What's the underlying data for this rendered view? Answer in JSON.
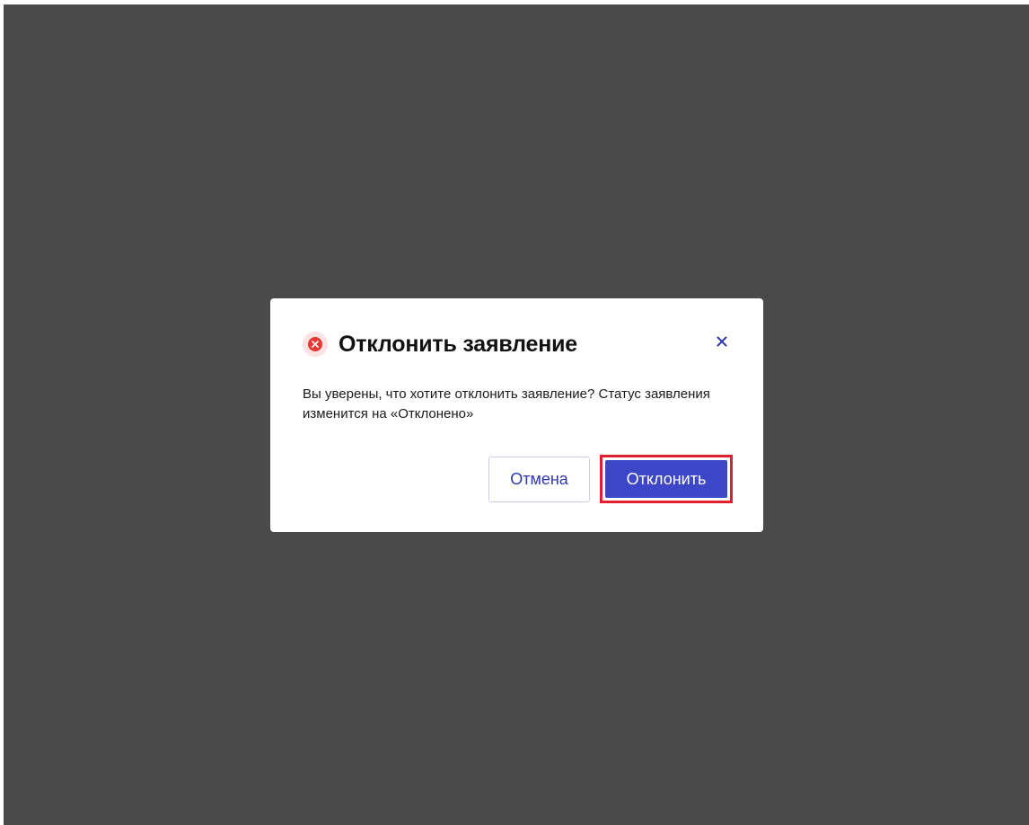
{
  "dialog": {
    "title": "Отклонить заявление",
    "message": "Вы уверены, что хотите отклонить заявление? Статус заявления изменится на «Отклонено»",
    "icon": "error-circle-icon",
    "close_icon": "close-icon",
    "cancel_label": "Отмена",
    "confirm_label": "Отклонить"
  },
  "colors": {
    "overlay": "#4a4a4a",
    "accent": "#3d45c8",
    "error": "#e53935",
    "highlight_border": "#e0202e"
  }
}
